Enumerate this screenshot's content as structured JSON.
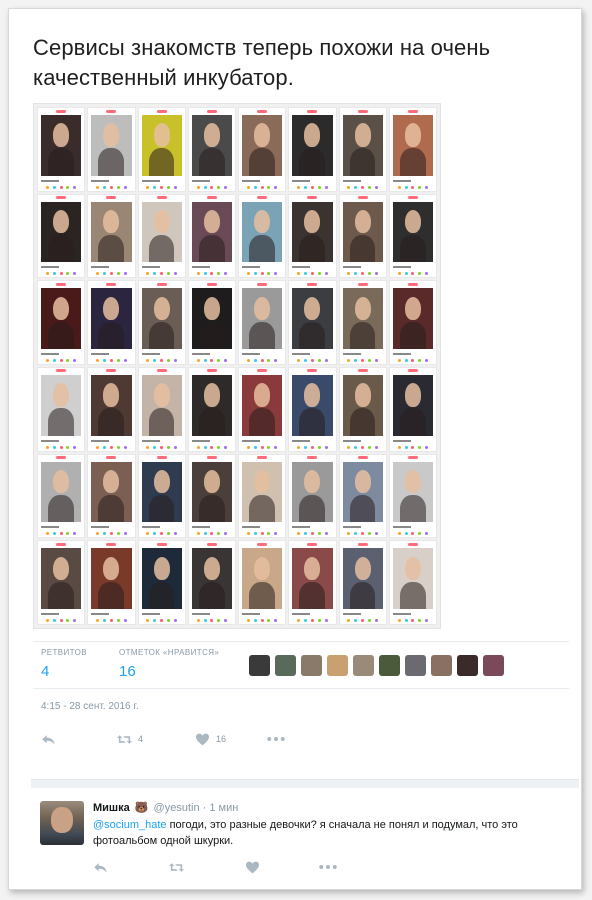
{
  "tweet": {
    "text": "Сервисы знакомств теперь похожи на очень качественный инкубатор.",
    "stats": {
      "retweets_label": "РЕТВИТОВ",
      "retweets_count": "4",
      "likes_label": "ОТМЕТОК «НРАВИТСЯ»",
      "likes_count": "16"
    },
    "timestamp": "4:15 - 28 сент. 2016 г.",
    "actions": {
      "reply_icon": "reply-icon",
      "retweet_icon": "retweet-icon",
      "retweet_count": "4",
      "like_icon": "heart-icon",
      "like_count": "16",
      "more_icon": "more-dots-icon"
    },
    "liker_avatars": 10
  },
  "photo_grid": {
    "rows": 6,
    "columns": 8,
    "description_icon": "dating-profile-card"
  },
  "reply": {
    "name": "Мишка",
    "emoji": "🐻",
    "handle": "@yesutin",
    "separator": "·",
    "time": "1 мин",
    "mention": "@socium_hate",
    "text": " погоди, это разные девочки? я сначала не понял и подумал, что это фотоальбом одной шкурки.",
    "actions": {
      "reply_icon": "reply-icon",
      "retweet_icon": "retweet-icon",
      "like_icon": "heart-icon",
      "more_icon": "more-dots-icon"
    }
  },
  "colors": {
    "accent": "#1da1f2",
    "muted": "#8899a6",
    "icon": "#aab8c2",
    "tinder_pink": "#ff6b7a"
  }
}
